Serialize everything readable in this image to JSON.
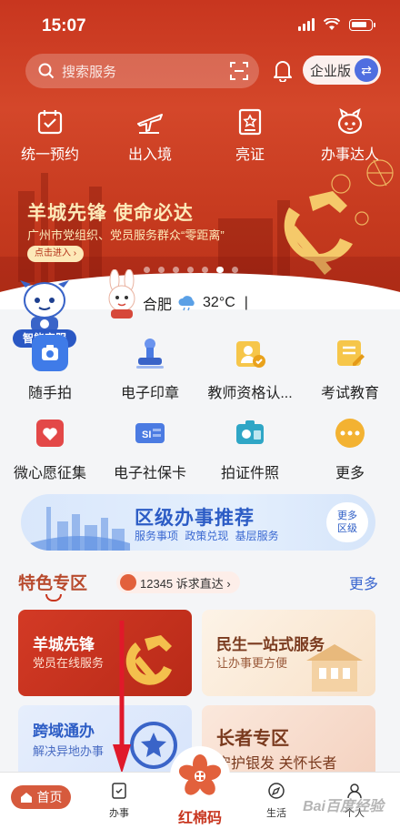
{
  "status_bar": {
    "time": "15:07"
  },
  "search": {
    "placeholder": "搜索服务"
  },
  "header": {
    "mode_label": "企业版",
    "mode_swap_glyph": "⇄"
  },
  "quick_actions": [
    {
      "label": "统一预约",
      "icon": "calendar-check-icon"
    },
    {
      "label": "出入境",
      "icon": "airplane-icon"
    },
    {
      "label": "亮证",
      "icon": "certificate-icon"
    },
    {
      "label": "办事达人",
      "icon": "mascot-icon"
    }
  ],
  "banner": {
    "title": "羊城先锋  使命必达",
    "subtitle": "广州市党组织、党员服务群众“零距离”",
    "button": "点击进入 ›",
    "slide_count": 7,
    "active_slide": 6
  },
  "location": {
    "city": "合肥",
    "temperature": "32°C",
    "separator": "|"
  },
  "assistant": {
    "label": "智能客服"
  },
  "services": [
    {
      "label": "随手拍",
      "icon": "camera-shot-icon",
      "color": "#3f7be8"
    },
    {
      "label": "电子印章",
      "icon": "seal-stamp-icon",
      "color": "#4b7be2"
    },
    {
      "label": "教师资格认...",
      "icon": "teacher-certificate-icon",
      "color": "#f0b233"
    },
    {
      "label": "考试教育",
      "icon": "exam-icon",
      "color": "#f0b233"
    },
    {
      "label": "微心愿征集",
      "icon": "heart-wish-icon",
      "color": "#e34848"
    },
    {
      "label": "电子社保卡",
      "icon": "social-security-card-icon",
      "color": "#4b7be2"
    },
    {
      "label": "拍证件照",
      "icon": "id-photo-icon",
      "color": "#2fa6c6"
    },
    {
      "label": "更多",
      "icon": "more-dots-icon",
      "color": "#f3b232"
    }
  ],
  "recommend": {
    "title": "区级办事推荐",
    "subtitle": "服务事项 政策兑现 基层服务",
    "more_line1": "更多",
    "more_line2": "区级"
  },
  "featured": {
    "title": "特色专区",
    "hotline": "12345 诉求直达 ›",
    "more": "更多",
    "cards": [
      {
        "title": "羊城先锋",
        "subtitle": "党员在线服务"
      },
      {
        "title": "民生一站式服务",
        "subtitle": "让办事更方便"
      },
      {
        "title": "跨域通办",
        "subtitle": "解决异地办事"
      },
      {
        "title": "长者专区",
        "subtitle": "守护银发 关怀长者"
      }
    ]
  },
  "tabbar": {
    "home": "首页",
    "handle": "办事",
    "center": "红棉码",
    "life": "生活",
    "personal": "个人"
  },
  "watermark": "Bai百度经验",
  "colors": {
    "primary_red": "#c8361f",
    "accent_blue": "#2c5cc5",
    "annotation_red": "#e0192a"
  }
}
